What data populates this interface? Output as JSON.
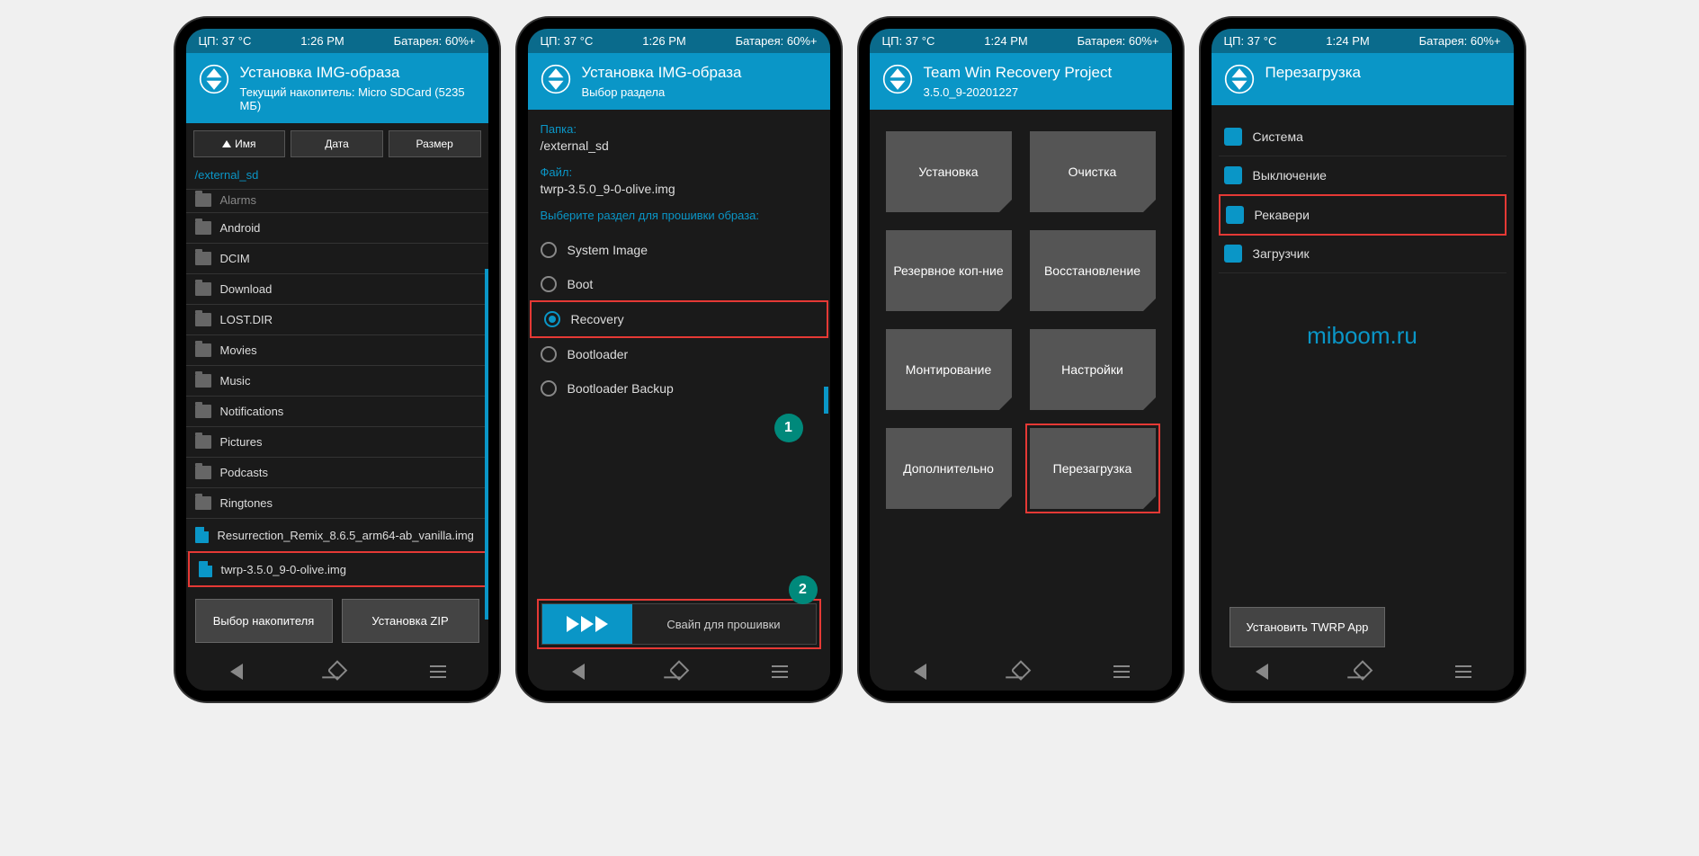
{
  "status": {
    "cpu": "ЦП: 37 °C",
    "time1": "1:26 PM",
    "time2": "1:24 PM",
    "battery": "Батарея: 60%+"
  },
  "p1": {
    "title": "Установка IMG-образа",
    "subtitle": "Текущий накопитель: Micro SDCard (5235 МБ)",
    "sort": {
      "name": "Имя",
      "date": "Дата",
      "size": "Размер"
    },
    "path": "/external_sd",
    "files": [
      "Alarms",
      "Android",
      "DCIM",
      "Download",
      "LOST.DIR",
      "Movies",
      "Music",
      "Notifications",
      "Pictures",
      "Podcasts",
      "Ringtones"
    ],
    "img_files": [
      "Resurrection_Remix_8.6.5_arm64-ab_vanilla.img",
      "twrp-3.5.0_9-0-olive.img"
    ],
    "btn_storage": "Выбор накопителя",
    "btn_zip": "Установка ZIP"
  },
  "p2": {
    "title": "Установка IMG-образа",
    "subtitle": "Выбор раздела",
    "folder_label": "Папка:",
    "folder_value": "/external_sd",
    "file_label": "Файл:",
    "file_value": "twrp-3.5.0_9-0-olive.img",
    "select_label": "Выберите раздел для прошивки образа:",
    "partitions": [
      "System Image",
      "Boot",
      "Recovery",
      "Bootloader",
      "Bootloader Backup"
    ],
    "selected_index": 2,
    "swipe_text": "Свайп для прошивки",
    "callout1": "1",
    "callout2": "2"
  },
  "p3": {
    "title": "Team Win Recovery Project",
    "subtitle": "3.5.0_9-20201227",
    "tiles": [
      "Установка",
      "Очистка",
      "Резервное коп-ние",
      "Восстановление",
      "Монтирование",
      "Настройки",
      "Дополнительно",
      "Перезагрузка"
    ]
  },
  "p4": {
    "title": "Перезагрузка",
    "options": [
      "Система",
      "Выключение",
      "Рекавери",
      "Загрузчик"
    ],
    "highlighted_index": 2,
    "watermark": "miboom.ru",
    "install_btn": "Установить TWRP App"
  }
}
